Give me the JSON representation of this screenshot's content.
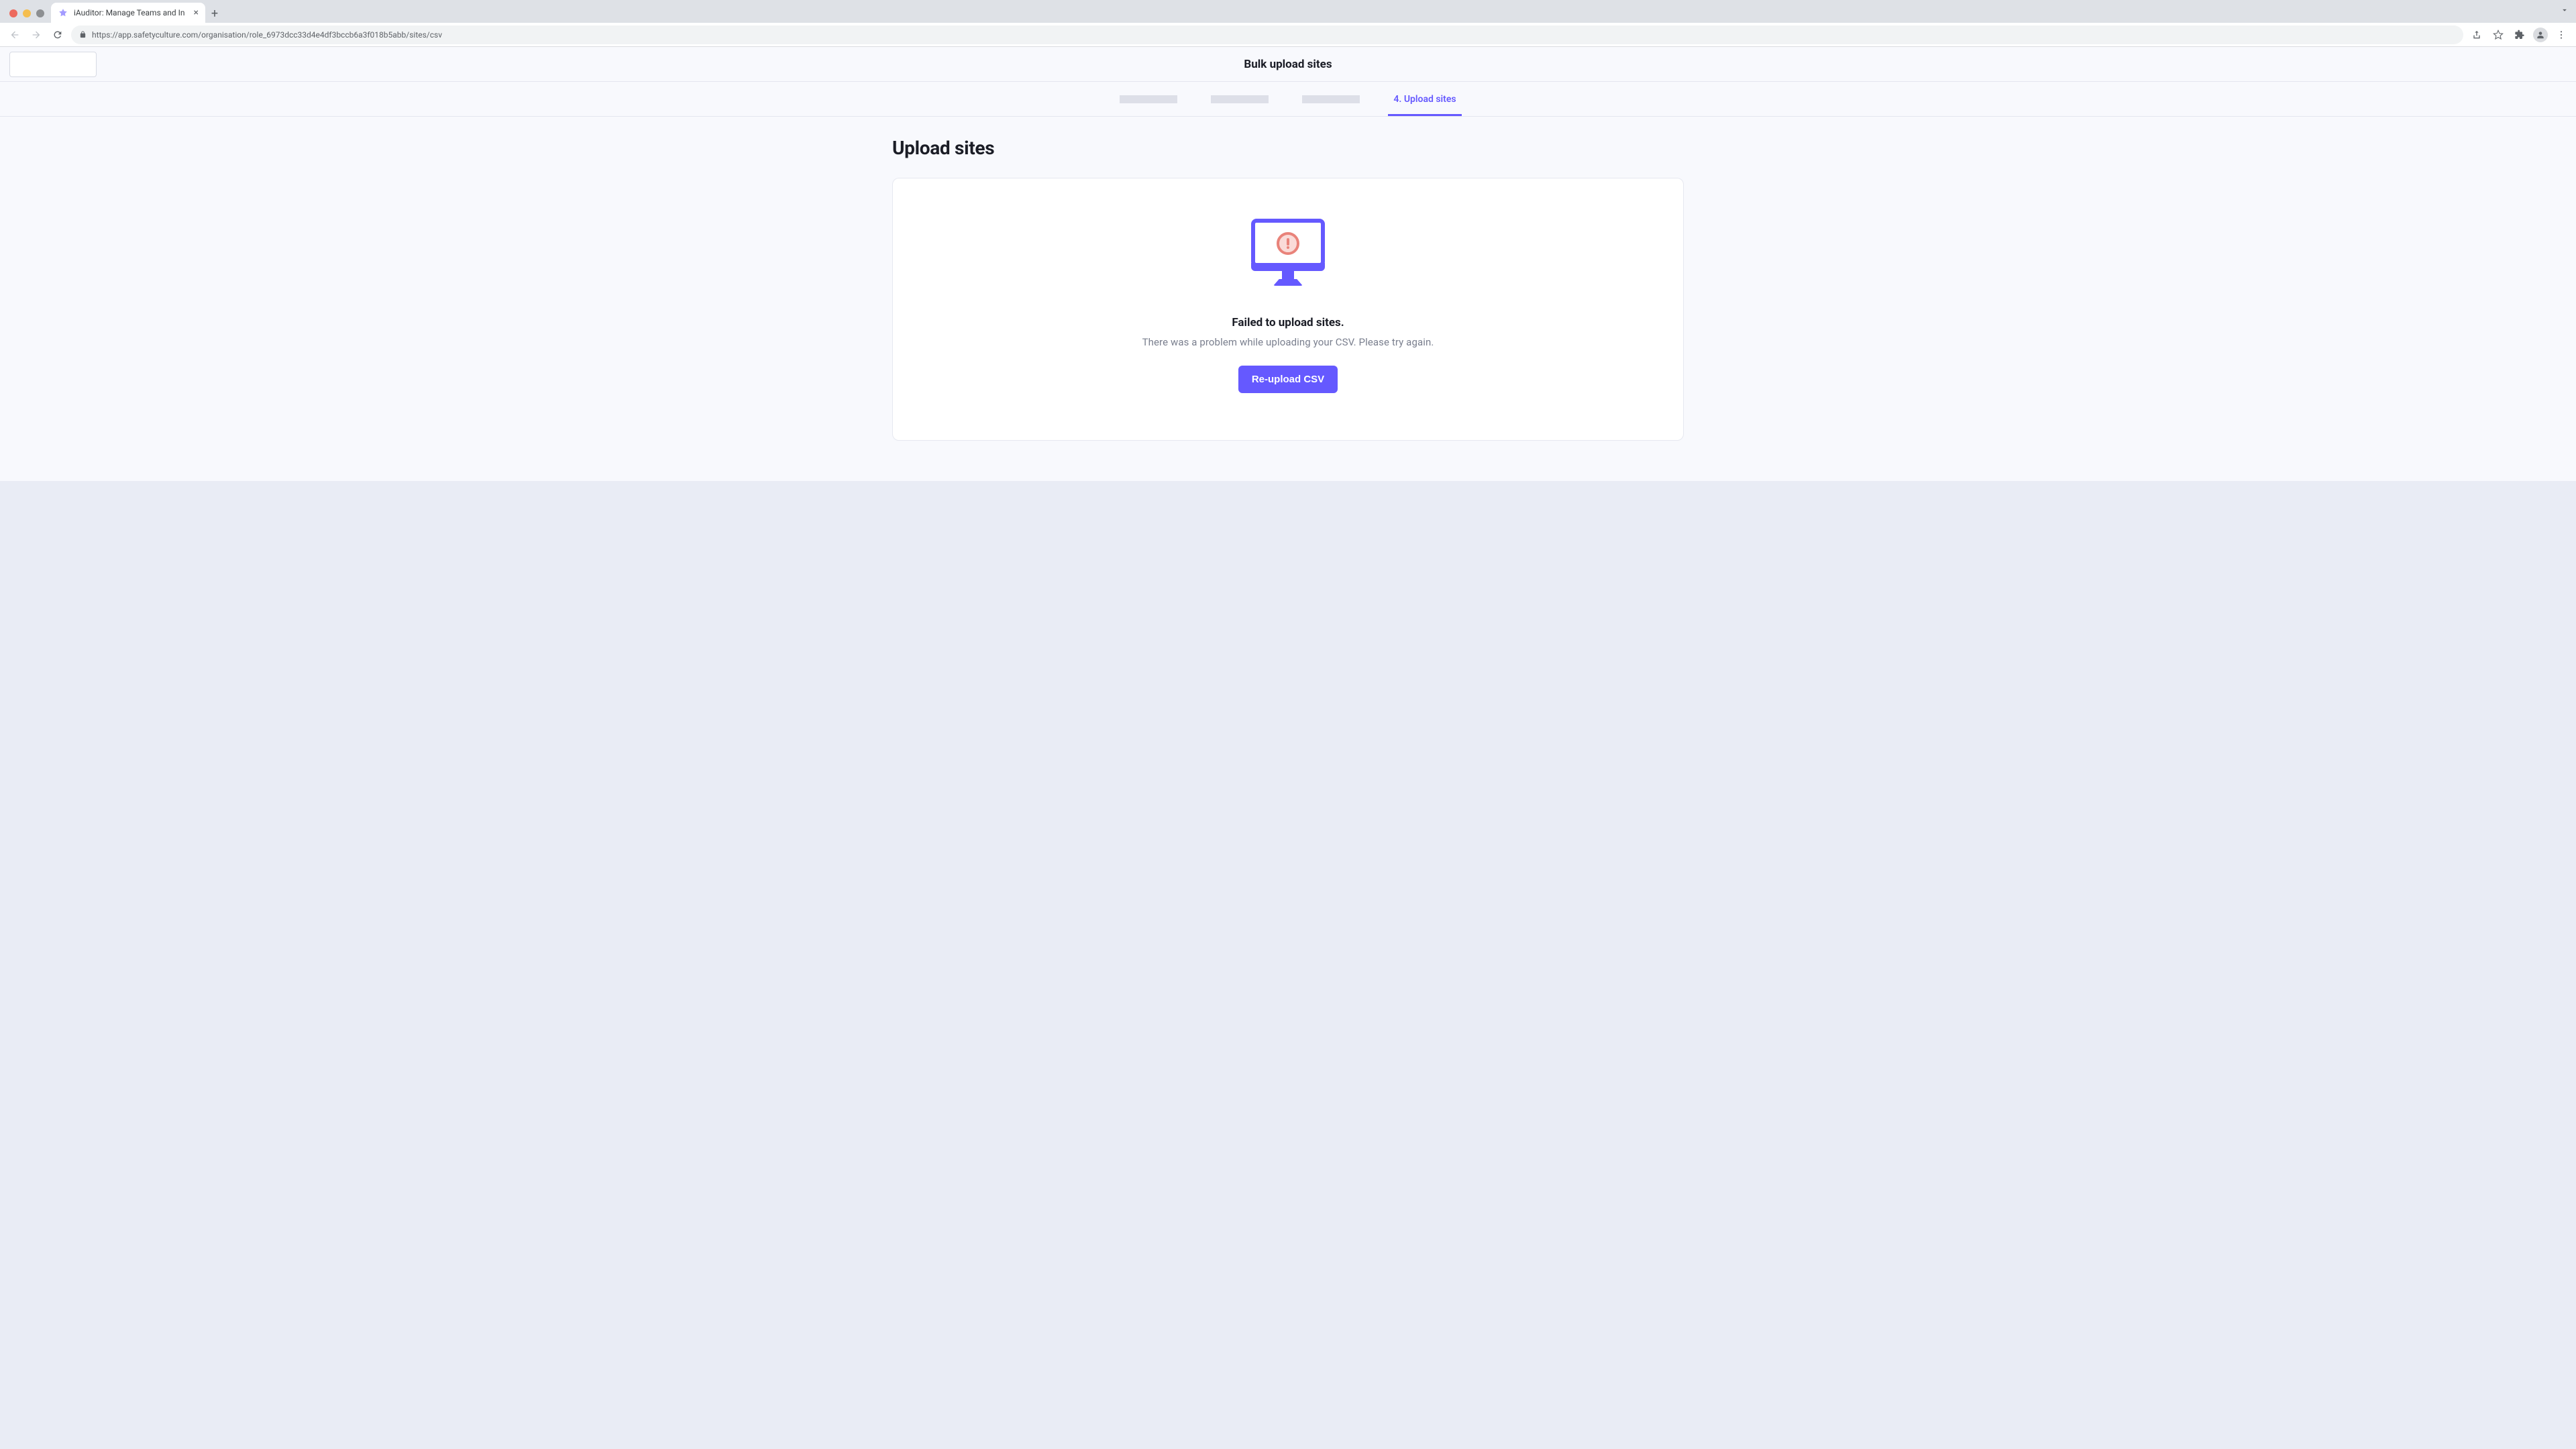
{
  "browser": {
    "tab_title": "iAuditor: Manage Teams and In",
    "url": "https://app.safetyculture.com/organisation/role_6973dcc33d4e4df3bccb6a3f018b5abb/sites/csv",
    "traffic_light_colors": {
      "close": "#ED6A5E",
      "min": "#F5BE4F",
      "max": "#8D8F92"
    }
  },
  "header": {
    "title": "Bulk upload sites"
  },
  "steps": {
    "active_label": "4. Upload sites"
  },
  "page": {
    "title": "Upload sites"
  },
  "error": {
    "title": "Failed to upload sites.",
    "description": "There was a problem while uploading your CSV. Please try again.",
    "button_label": "Re-upload CSV"
  },
  "colors": {
    "accent": "#6559FF",
    "alert": "#E9837A"
  }
}
